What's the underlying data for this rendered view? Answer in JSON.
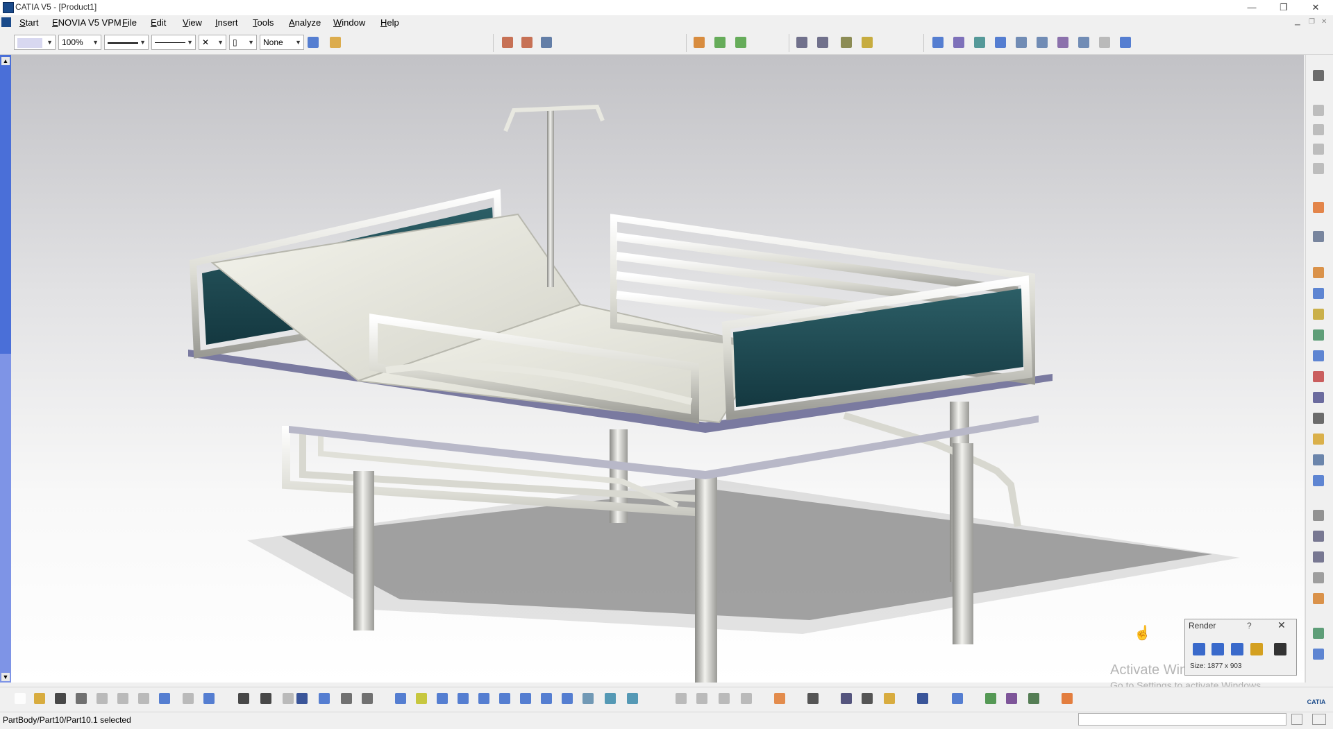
{
  "window": {
    "title": "CATIA V5 - [Product1]",
    "controls": {
      "minimize": "—",
      "restore": "❐",
      "close": "✕"
    }
  },
  "menubar": {
    "items": [
      "Start",
      "ENOVIA V5 VPM",
      "File",
      "Edit",
      "View",
      "Insert",
      "Tools",
      "Analyze",
      "Window",
      "Help"
    ]
  },
  "toolbar": {
    "zoom_value": "100%",
    "layer_value": "None"
  },
  "render_panel": {
    "title": "Render",
    "help": "?",
    "close": "✕",
    "size_text": "Size: 1877 x 903"
  },
  "watermark": {
    "line1": "Activate Windows",
    "line2": "Go to Settings to activate Windows."
  },
  "status": {
    "text": "PartBody/Part10/Part10.1 selected"
  },
  "colors": {
    "accent": "#1a4a8a",
    "scrollbar": "#4a6fd8",
    "bed_panel": "#1f4a52",
    "bed_frame": "#e4e4dc"
  }
}
